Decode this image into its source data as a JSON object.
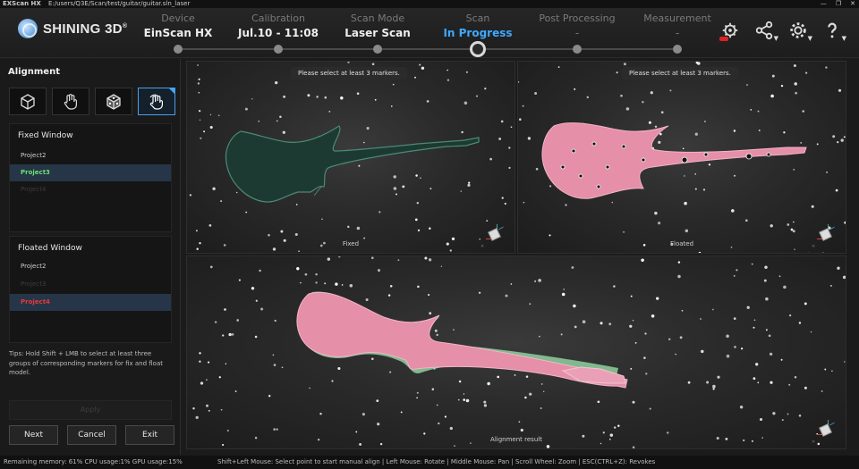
{
  "titlebar": {
    "app_name": "EXScan HX",
    "path": "E:/users/Q3E/Scan/test/guitar/guitar.sln_laser",
    "buttons": [
      "—",
      "❐",
      "✕"
    ]
  },
  "brand": {
    "name": "SHINING 3D",
    "reg": "®"
  },
  "steps": [
    {
      "label": "Device",
      "value": "EinScan HX"
    },
    {
      "label": "Calibration",
      "value": "Jul.10 - 11:08"
    },
    {
      "label": "Scan Mode",
      "value": "Laser Scan"
    },
    {
      "label": "Scan",
      "value": "In Progress"
    },
    {
      "label": "Post Processing",
      "value": "-"
    },
    {
      "label": "Measurement",
      "value": "-"
    }
  ],
  "toolbar_icons": [
    "remote-service-icon",
    "share-icon",
    "settings-icon",
    "help-icon"
  ],
  "accent_color": "#3fa8ff",
  "left_panel": {
    "title": "Alignment",
    "modes": [
      "cube-align-icon",
      "hand-select-icon",
      "marker-align-icon",
      "manual-align-icon"
    ],
    "fixed_window": {
      "title": "Fixed Window",
      "items": [
        "Project2",
        "Project3",
        "Project4"
      ]
    },
    "floated_window": {
      "title": "Floated Window",
      "items": [
        "Project2",
        "Project3",
        "Project4"
      ]
    },
    "tips": "Tips: Hold Shift + LMB to select at least three groups of corresponding markers for fix and float model.",
    "apply_label": "Apply",
    "next_label": "Next",
    "cancel_label": "Cancel",
    "exit_label": "Exit"
  },
  "viewports": {
    "fixed": {
      "message": "Please select at least 3 markers.",
      "label": "Fixed"
    },
    "floated": {
      "message": "Please select at least 3 markers.",
      "label": "Floated"
    },
    "result": {
      "label": "Alignment result"
    }
  },
  "statusbar": {
    "resources": "Remaining memory: 61% CPU usage:1%  GPU usage:15%",
    "hints": "Shift+Left Mouse: Select point to start manual align | Left Mouse: Rotate | Middle Mouse: Pan | Scroll Wheel: Zoom | ESC(CTRL+Z): Revokes"
  }
}
